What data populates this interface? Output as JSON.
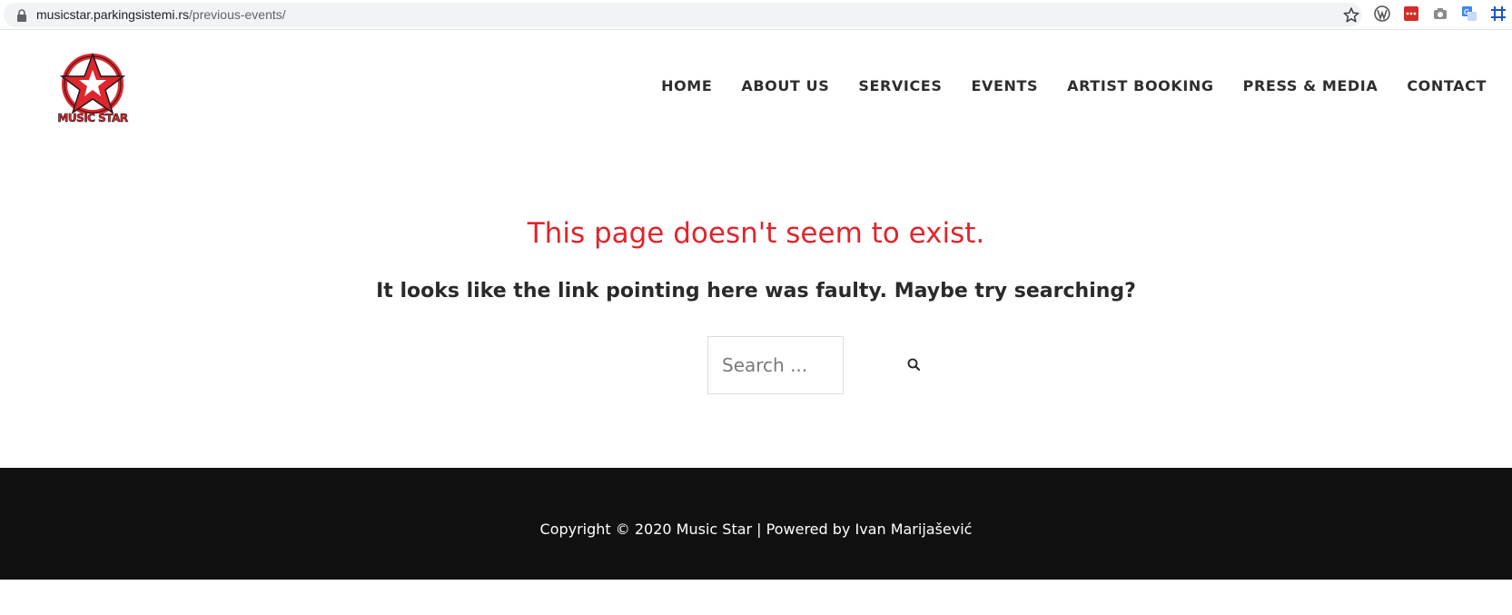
{
  "browser": {
    "url_host": "musicstar.parkingsistemi.rs",
    "url_path": "/previous-events/",
    "extensions": [
      "wordpress-icon",
      "lastpass-icon",
      "camera-icon",
      "google-translate-icon",
      "grid-extension-icon"
    ]
  },
  "logo": {
    "text": "MUSIC STAR",
    "color": "#e0252c"
  },
  "nav": {
    "items": [
      {
        "label": "HOME"
      },
      {
        "label": "ABOUT US"
      },
      {
        "label": "SERVICES"
      },
      {
        "label": "EVENTS"
      },
      {
        "label": "ARTIST BOOKING"
      },
      {
        "label": "PRESS & MEDIA"
      },
      {
        "label": "CONTACT"
      }
    ]
  },
  "content": {
    "title": "This page doesn't seem to exist.",
    "subtitle": "It looks like the link pointing here was faulty. Maybe try searching?",
    "search_placeholder": "Search ...",
    "search_icon": "search-icon"
  },
  "footer": {
    "copyright": "Copyright © 2020 Music Star | Powered by Ivan Marijašević"
  },
  "colors": {
    "accent": "#e0252c",
    "footer_bg": "#111111",
    "text_dark": "#2a2a2a"
  }
}
